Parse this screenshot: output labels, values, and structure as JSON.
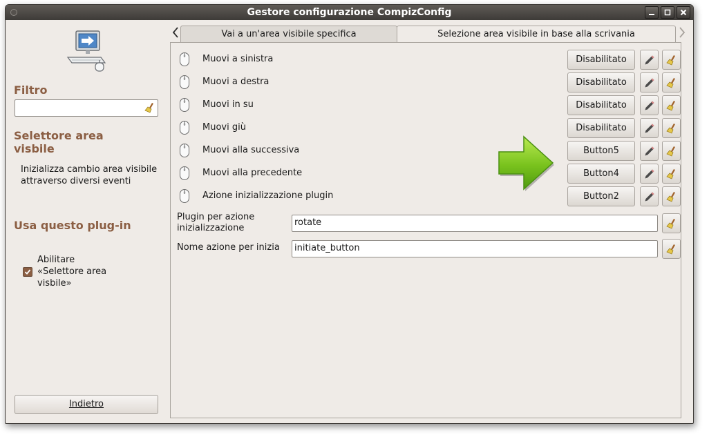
{
  "window": {
    "title": "Gestore configurazione CompizConfig"
  },
  "sidebar": {
    "filter_heading": "Filtro",
    "filter_value": "",
    "plugin_heading": "Selettore area visbile",
    "plugin_description": "Inizializza cambio area visibile attraverso diversi eventi",
    "enable_heading": "Usa questo plug-in",
    "enable_label": "Abilitare «Selettore area visbile»",
    "enable_checked": true,
    "back_button": "Indietro"
  },
  "tabs": [
    {
      "label": "Vai a un'area visibile specifica",
      "active": false
    },
    {
      "label": "Selezione area visibile in base alla scrivania",
      "active": true
    }
  ],
  "rows": [
    {
      "label": "Muovi a sinistra",
      "binding": "Disabilitato"
    },
    {
      "label": "Muovi a destra",
      "binding": "Disabilitato"
    },
    {
      "label": "Muovi in su",
      "binding": "Disabilitato"
    },
    {
      "label": "Muovi giù",
      "binding": "Disabilitato"
    },
    {
      "label": "Muovi alla successiva",
      "binding": "Button5"
    },
    {
      "label": "Muovi alla precedente",
      "binding": "Button4"
    },
    {
      "label": "Azione inizializzazione plugin",
      "binding": "Button2"
    }
  ],
  "fields": [
    {
      "label": "Plugin per azione inizializzazione",
      "value": "rotate"
    },
    {
      "label": "Nome azione per inizia",
      "value": "initiate_button"
    }
  ],
  "colors": {
    "accent_heading": "#8b5e43",
    "arrow_green": "#7cc21f",
    "titlebar": "#4a4643",
    "window_bg": "#efebe7"
  },
  "icons": {
    "plugin": "computer-arrow-icon",
    "row": "mouse-icon",
    "edit": "pencil-icon",
    "reset": "broom-icon",
    "overlay": "green-arrow-icon"
  }
}
